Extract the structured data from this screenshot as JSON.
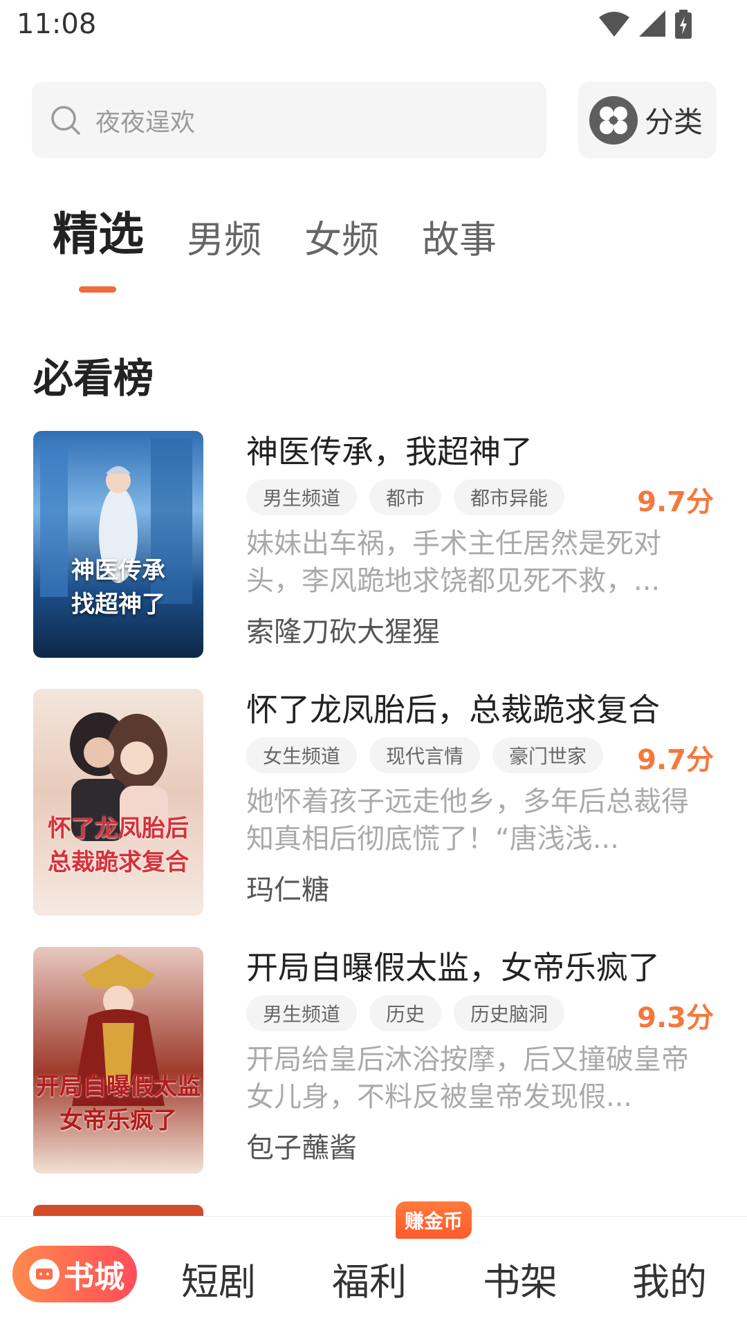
{
  "status": {
    "time": "11:08"
  },
  "search": {
    "placeholder": "夜夜逞欢"
  },
  "category": {
    "label": "分类"
  },
  "tabs": [
    {
      "label": "精选"
    },
    {
      "label": "男频"
    },
    {
      "label": "女频"
    },
    {
      "label": "故事"
    }
  ],
  "section": {
    "title": "必看榜"
  },
  "books": [
    {
      "title": "神医传承，我超神了",
      "tags": [
        "男生频道",
        "都市",
        "都市异能"
      ],
      "score": "9.7分",
      "description": "妹妹出车祸，手术主任居然是死对头，李风跪地求饶都见死不救，...",
      "author": "索隆刀砍大猩猩",
      "cover_text": "神医传承\n找超神了"
    },
    {
      "title": "怀了龙凤胎后，总裁跪求复合",
      "tags": [
        "女生频道",
        "现代言情",
        "豪门世家"
      ],
      "score": "9.7分",
      "description": "她怀着孩子远走他乡，多年后总裁得知真相后彻底慌了！“唐浅浅...",
      "author": "玛仁糖",
      "cover_text": "怀了龙凤胎后\n总裁跪求复合"
    },
    {
      "title": "开局自曝假太监，女帝乐疯了",
      "tags": [
        "男生频道",
        "历史",
        "历史脑洞"
      ],
      "score": "9.3分",
      "description": "开局给皇后沐浴按摩，后又撞破皇帝女儿身，不料反被皇帝发现假...",
      "author": "包子蘸酱",
      "cover_text": "开局自曝假太监\n女帝乐疯了"
    }
  ],
  "bottom_nav": {
    "bookstore": "书城",
    "drama": "短剧",
    "welfare": "福利",
    "bookshelf": "书架",
    "mine": "我的",
    "earn_badge": "赚金币"
  },
  "colors": {
    "accent": "#f26b3a",
    "score": "#f5783c"
  }
}
